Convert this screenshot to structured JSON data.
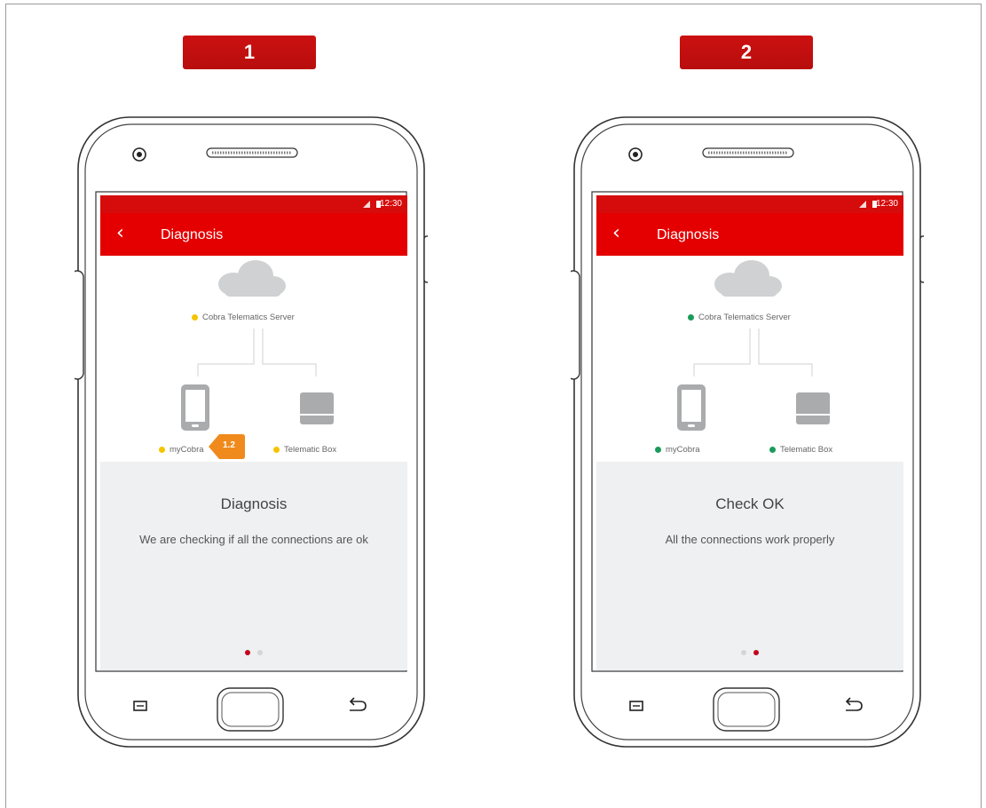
{
  "colors": {
    "accent_red": "#e40000",
    "dot_pending": "#f5c400",
    "dot_ok": "#1a9b5a",
    "pager_active": "#c4001a",
    "pager_inactive": "#d2d6da",
    "callout": "#f08a1c"
  },
  "steps": [
    {
      "number": "1",
      "status_time": "12:30",
      "back_icon": "chevron-left-icon",
      "app_title": "Diagnosis",
      "server_label": "Cobra Telematics Server",
      "phone_label": "myCobra",
      "box_label": "Telematic Box",
      "status": "pending",
      "heading": "Diagnosis",
      "description": "We are checking if all the connections are ok",
      "callout": "1.2",
      "pager_active_index": 0
    },
    {
      "number": "2",
      "status_time": "12:30",
      "back_icon": "chevron-left-icon",
      "app_title": "Diagnosis",
      "server_label": "Cobra Telematics Server",
      "phone_label": "myCobra",
      "box_label": "Telematic Box",
      "status": "ok",
      "heading": "Check OK",
      "description": "All the connections work properly",
      "pager_active_index": 1
    }
  ]
}
